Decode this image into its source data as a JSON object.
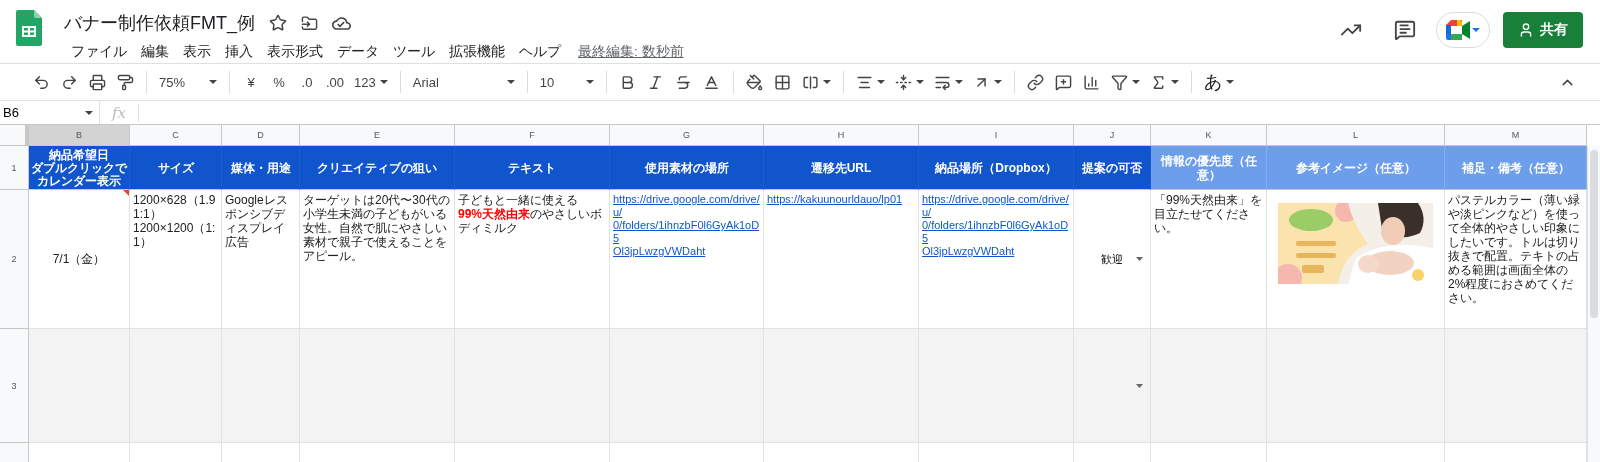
{
  "document": {
    "title": "バナー制作依頼FMT_例",
    "last_edit": "最終編集: 数秒前"
  },
  "menu": [
    "ファイル",
    "編集",
    "表示",
    "挿入",
    "表示形式",
    "データ",
    "ツール",
    "拡張機能",
    "ヘルプ"
  ],
  "share_button": {
    "label": "共有"
  },
  "toolbar": {
    "zoom": "75%",
    "currency": "¥",
    "percent": "%",
    "decrease_decimal": ".0",
    "increase_decimal": ".00",
    "number_format": "123",
    "font": "Arial",
    "font_size": "10",
    "input_tools": "あ"
  },
  "formula_bar": {
    "cell_ref": "B6",
    "fx": "fx"
  },
  "sheet": {
    "column_letters": [
      {
        "label": "B",
        "selected": true
      },
      {
        "label": "C",
        "selected": false
      },
      {
        "label": "D",
        "selected": false
      },
      {
        "label": "E",
        "selected": false
      },
      {
        "label": "F",
        "selected": false
      },
      {
        "label": "G",
        "selected": false
      },
      {
        "label": "H",
        "selected": false
      },
      {
        "label": "I",
        "selected": false
      },
      {
        "label": "J",
        "selected": false
      },
      {
        "label": "K",
        "selected": false
      },
      {
        "label": "L",
        "selected": false
      },
      {
        "label": "M",
        "selected": false
      }
    ],
    "header_row": {
      "number": "1",
      "cells": [
        {
          "text": "納品希望日",
          "note": "ダブルクリックでカレンダー表示",
          "kind": "required"
        },
        {
          "text": "サイズ",
          "kind": "required"
        },
        {
          "text": "媒体・用途",
          "kind": "required"
        },
        {
          "text": "クリエイティブの狙い",
          "kind": "required"
        },
        {
          "text": "テキスト",
          "kind": "required"
        },
        {
          "text": "使用素材の場所",
          "kind": "required"
        },
        {
          "text": "遷移先URL",
          "kind": "required"
        },
        {
          "text": "納品場所（Dropbox）",
          "kind": "required"
        },
        {
          "text": "提案の可否",
          "kind": "required"
        },
        {
          "text": "情報の優先度（任意）",
          "kind": "optional"
        },
        {
          "text": "参考イメージ（任意）",
          "kind": "optional"
        },
        {
          "text": "補足・備考（任意）",
          "kind": "optional"
        }
      ]
    },
    "rows": [
      {
        "number": "2",
        "shaded": false,
        "cells": [
          {
            "kind": "date",
            "text": "7/1（金）",
            "comment": true
          },
          {
            "kind": "text",
            "text": "1200×628（1.91:1）\n1200×1200（1:1）"
          },
          {
            "kind": "text",
            "text": "Googleレスポンシブディスプレイ広告"
          },
          {
            "kind": "text",
            "text": "ターゲットは20代〜30代の小学生未満の子どもがいる女性。自然で肌にやさしい素材で親子で使えることをアピール。"
          },
          {
            "kind": "text",
            "text": "子どもと一緒に使える\n**99%天然由来**のやさしいボディミルク"
          },
          {
            "kind": "link",
            "lines": [
              "https://drive.google.com/drive/u/",
              "0/folders/1ihnzbF0l6GyAk1oD5",
              "Ol3jpLwzgVWDaht"
            ]
          },
          {
            "kind": "link",
            "lines": [
              "https://kakuunourldauo/lp01"
            ]
          },
          {
            "kind": "link",
            "lines": [
              "https://drive.google.com/drive/u/",
              "0/folders/1ihnzbF0l6GyAk1oD5",
              "Ol3jpLwzgVWDaht"
            ]
          },
          {
            "kind": "dropdown",
            "value": "歓迎"
          },
          {
            "kind": "text",
            "text": "「99%天然由来」を目立たせてください。"
          },
          {
            "kind": "picture"
          },
          {
            "kind": "text",
            "text": "パステルカラー（薄い緑や淡ピンクなど）を使って全体的やさしい印象にしたいです。トルは切り抜きで配置。テキトの占める範囲は画面全体の2%程度におさめてください。"
          }
        ]
      },
      {
        "number": "3",
        "shaded": true,
        "cells": [
          {
            "kind": "empty"
          },
          {
            "kind": "empty"
          },
          {
            "kind": "empty"
          },
          {
            "kind": "empty"
          },
          {
            "kind": "empty"
          },
          {
            "kind": "empty"
          },
          {
            "kind": "empty"
          },
          {
            "kind": "empty"
          },
          {
            "kind": "dropdown"
          },
          {
            "kind": "empty"
          },
          {
            "kind": "empty"
          },
          {
            "kind": "empty"
          }
        ]
      }
    ]
  }
}
